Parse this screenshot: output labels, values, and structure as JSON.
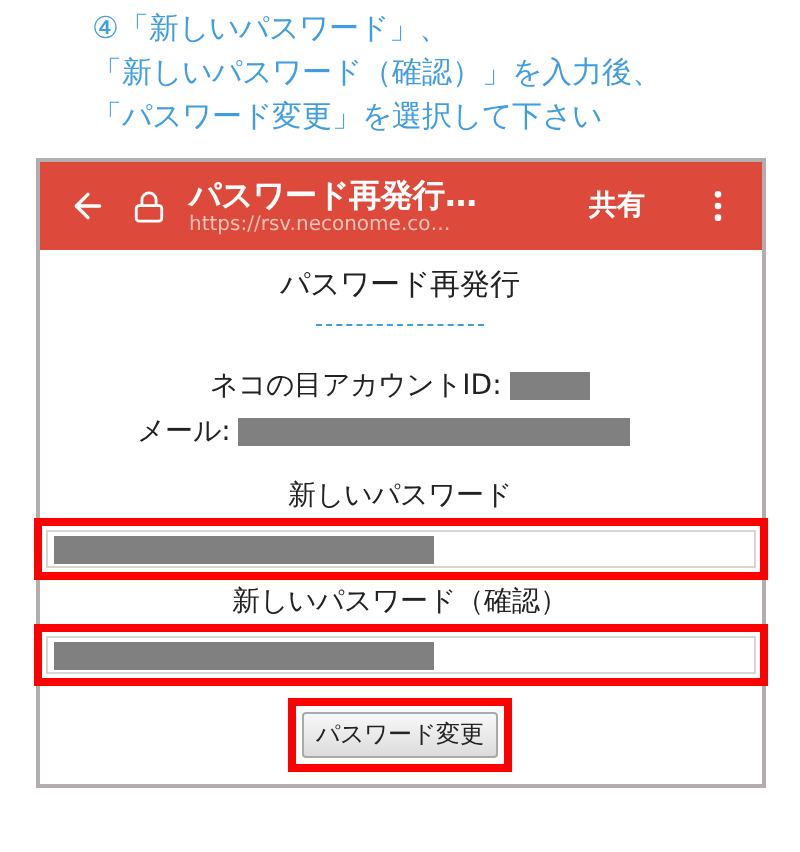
{
  "instruction": [
    "④「新しいパスワード」、",
    "「新しいパスワード（確認）」を入力後、",
    "「パスワード変更」を選択して下さい"
  ],
  "toolbar": {
    "title": "パスワード再発行…",
    "url": "https://rsv.neconome.co…",
    "action": "共有"
  },
  "page": {
    "heading": "パスワード再発行",
    "account_label": "ネコの目アカウントID:",
    "mail_label": "メール:",
    "fields": [
      {
        "label": "新しいパスワード",
        "highlighted": true
      },
      {
        "label": "新しいパスワード（確認）",
        "highlighted": true
      }
    ],
    "submit": {
      "label": "パスワード変更",
      "highlighted": true
    }
  }
}
